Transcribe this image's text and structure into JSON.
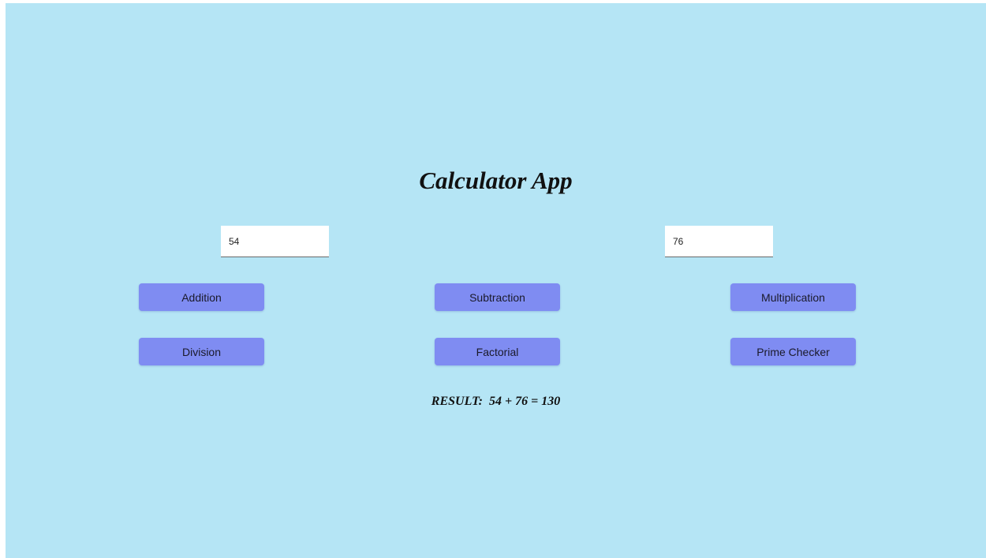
{
  "app": {
    "title": "Calculator App"
  },
  "inputs": {
    "first_value": "54",
    "second_value": "76"
  },
  "buttons": {
    "addition": "Addition",
    "subtraction": "Subtraction",
    "multiplication": "Multiplication",
    "division": "Division",
    "factorial": "Factorial",
    "prime_checker": "Prime Checker"
  },
  "result": {
    "label": "RESULT:",
    "expression": "54 + 76 = 130"
  },
  "colors": {
    "background": "#b5e5f5",
    "button": "#7f8cf2"
  }
}
